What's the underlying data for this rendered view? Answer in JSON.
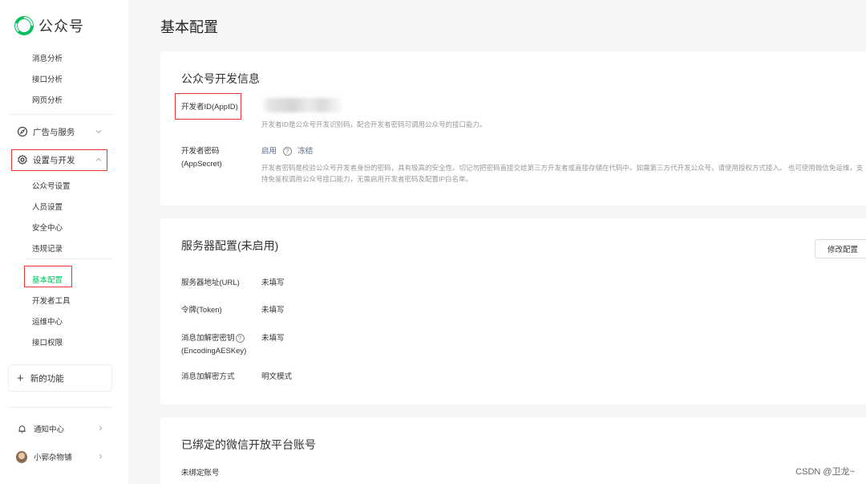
{
  "brand": {
    "name": "公众号"
  },
  "sidebar": {
    "stats_items": [
      "消息分析",
      "接口分析",
      "网页分析"
    ],
    "ads_group": {
      "label": "广告与服务",
      "icon": "compass-icon"
    },
    "settings_group": {
      "label": "设置与开发",
      "icon": "gear-icon"
    },
    "settings_items": [
      "公众号设置",
      "人员设置",
      "安全中心",
      "违规记录"
    ],
    "dev_items": [
      "基本配置",
      "开发者工具",
      "运维中心",
      "接口权限"
    ],
    "new_feature": "新的功能",
    "notifications": "通知中心",
    "account": "小郭杂物铺",
    "accent_color": "#07c160",
    "highlight_color": "#e33333"
  },
  "main": {
    "title": "基本配置",
    "dev_info": {
      "title": "公众号开发信息",
      "appid_label": "开发者ID(AppID)",
      "appid_desc": "开发者ID是公众号开发识别码，配合开发者密码可调用公众号的接口能力。",
      "secret_label": "开发者密码(AppSecret)",
      "enable_link": "启用",
      "freeze_link": "冻结",
      "secret_desc": "开发者密码是校验公众号开发者身份的密码，具有极高的安全性。切记勿把密码直接交给第三方开发者或直接存储在代码中。如需第三方代开发公众号，请使用授权方式接入。 也可使用微信免运维，支持免鉴权调用公众号接口能力，无需启用开发者密码及配置IP白名单。"
    },
    "server": {
      "title": "服务器配置(未启用)",
      "modify_button": "修改配置",
      "rows": [
        {
          "label": "服务器地址(URL)",
          "value": "未填写"
        },
        {
          "label": "令牌(Token)",
          "value": "未填写"
        },
        {
          "label_line1": "消息加解密密钥",
          "label_line2": "(EncodingAESKey)",
          "value": "未填写"
        },
        {
          "label": "消息加解密方式",
          "value": "明文模式"
        }
      ]
    },
    "open_platform": {
      "title": "已绑定的微信开放平台账号",
      "status": "未绑定账号"
    }
  },
  "watermark": "CSDN @卫龙~"
}
